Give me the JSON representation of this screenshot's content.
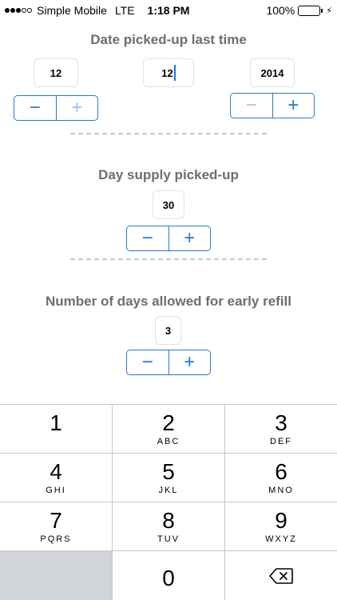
{
  "status_bar": {
    "carrier": "Simple Mobile",
    "network": "LTE",
    "time": "1:18 PM",
    "battery_percent": "100%",
    "battery_level": 1.0,
    "battery_color": "#4cd964"
  },
  "date_section": {
    "title": "Date picked-up last time",
    "month": "12",
    "day": "12",
    "year": "2014"
  },
  "supply_section": {
    "title": "Day supply picked-up",
    "value": "30"
  },
  "refill_section": {
    "title": "Number of days allowed for early refill",
    "value": "3"
  },
  "stepper": {
    "minus": "−",
    "plus": "+"
  },
  "keypad": {
    "rows": [
      [
        {
          "digit": "1",
          "letters": ""
        },
        {
          "digit": "2",
          "letters": "ABC"
        },
        {
          "digit": "3",
          "letters": "DEF"
        }
      ],
      [
        {
          "digit": "4",
          "letters": "GHI"
        },
        {
          "digit": "5",
          "letters": "JKL"
        },
        {
          "digit": "6",
          "letters": "MNO"
        }
      ],
      [
        {
          "digit": "7",
          "letters": "PQRS"
        },
        {
          "digit": "8",
          "letters": "TUV"
        },
        {
          "digit": "9",
          "letters": "WXYZ"
        }
      ]
    ],
    "zero": "0",
    "delete_icon": "backspace-icon"
  },
  "colors": {
    "accent": "#2a7ac6",
    "heading": "#6d6d72"
  }
}
